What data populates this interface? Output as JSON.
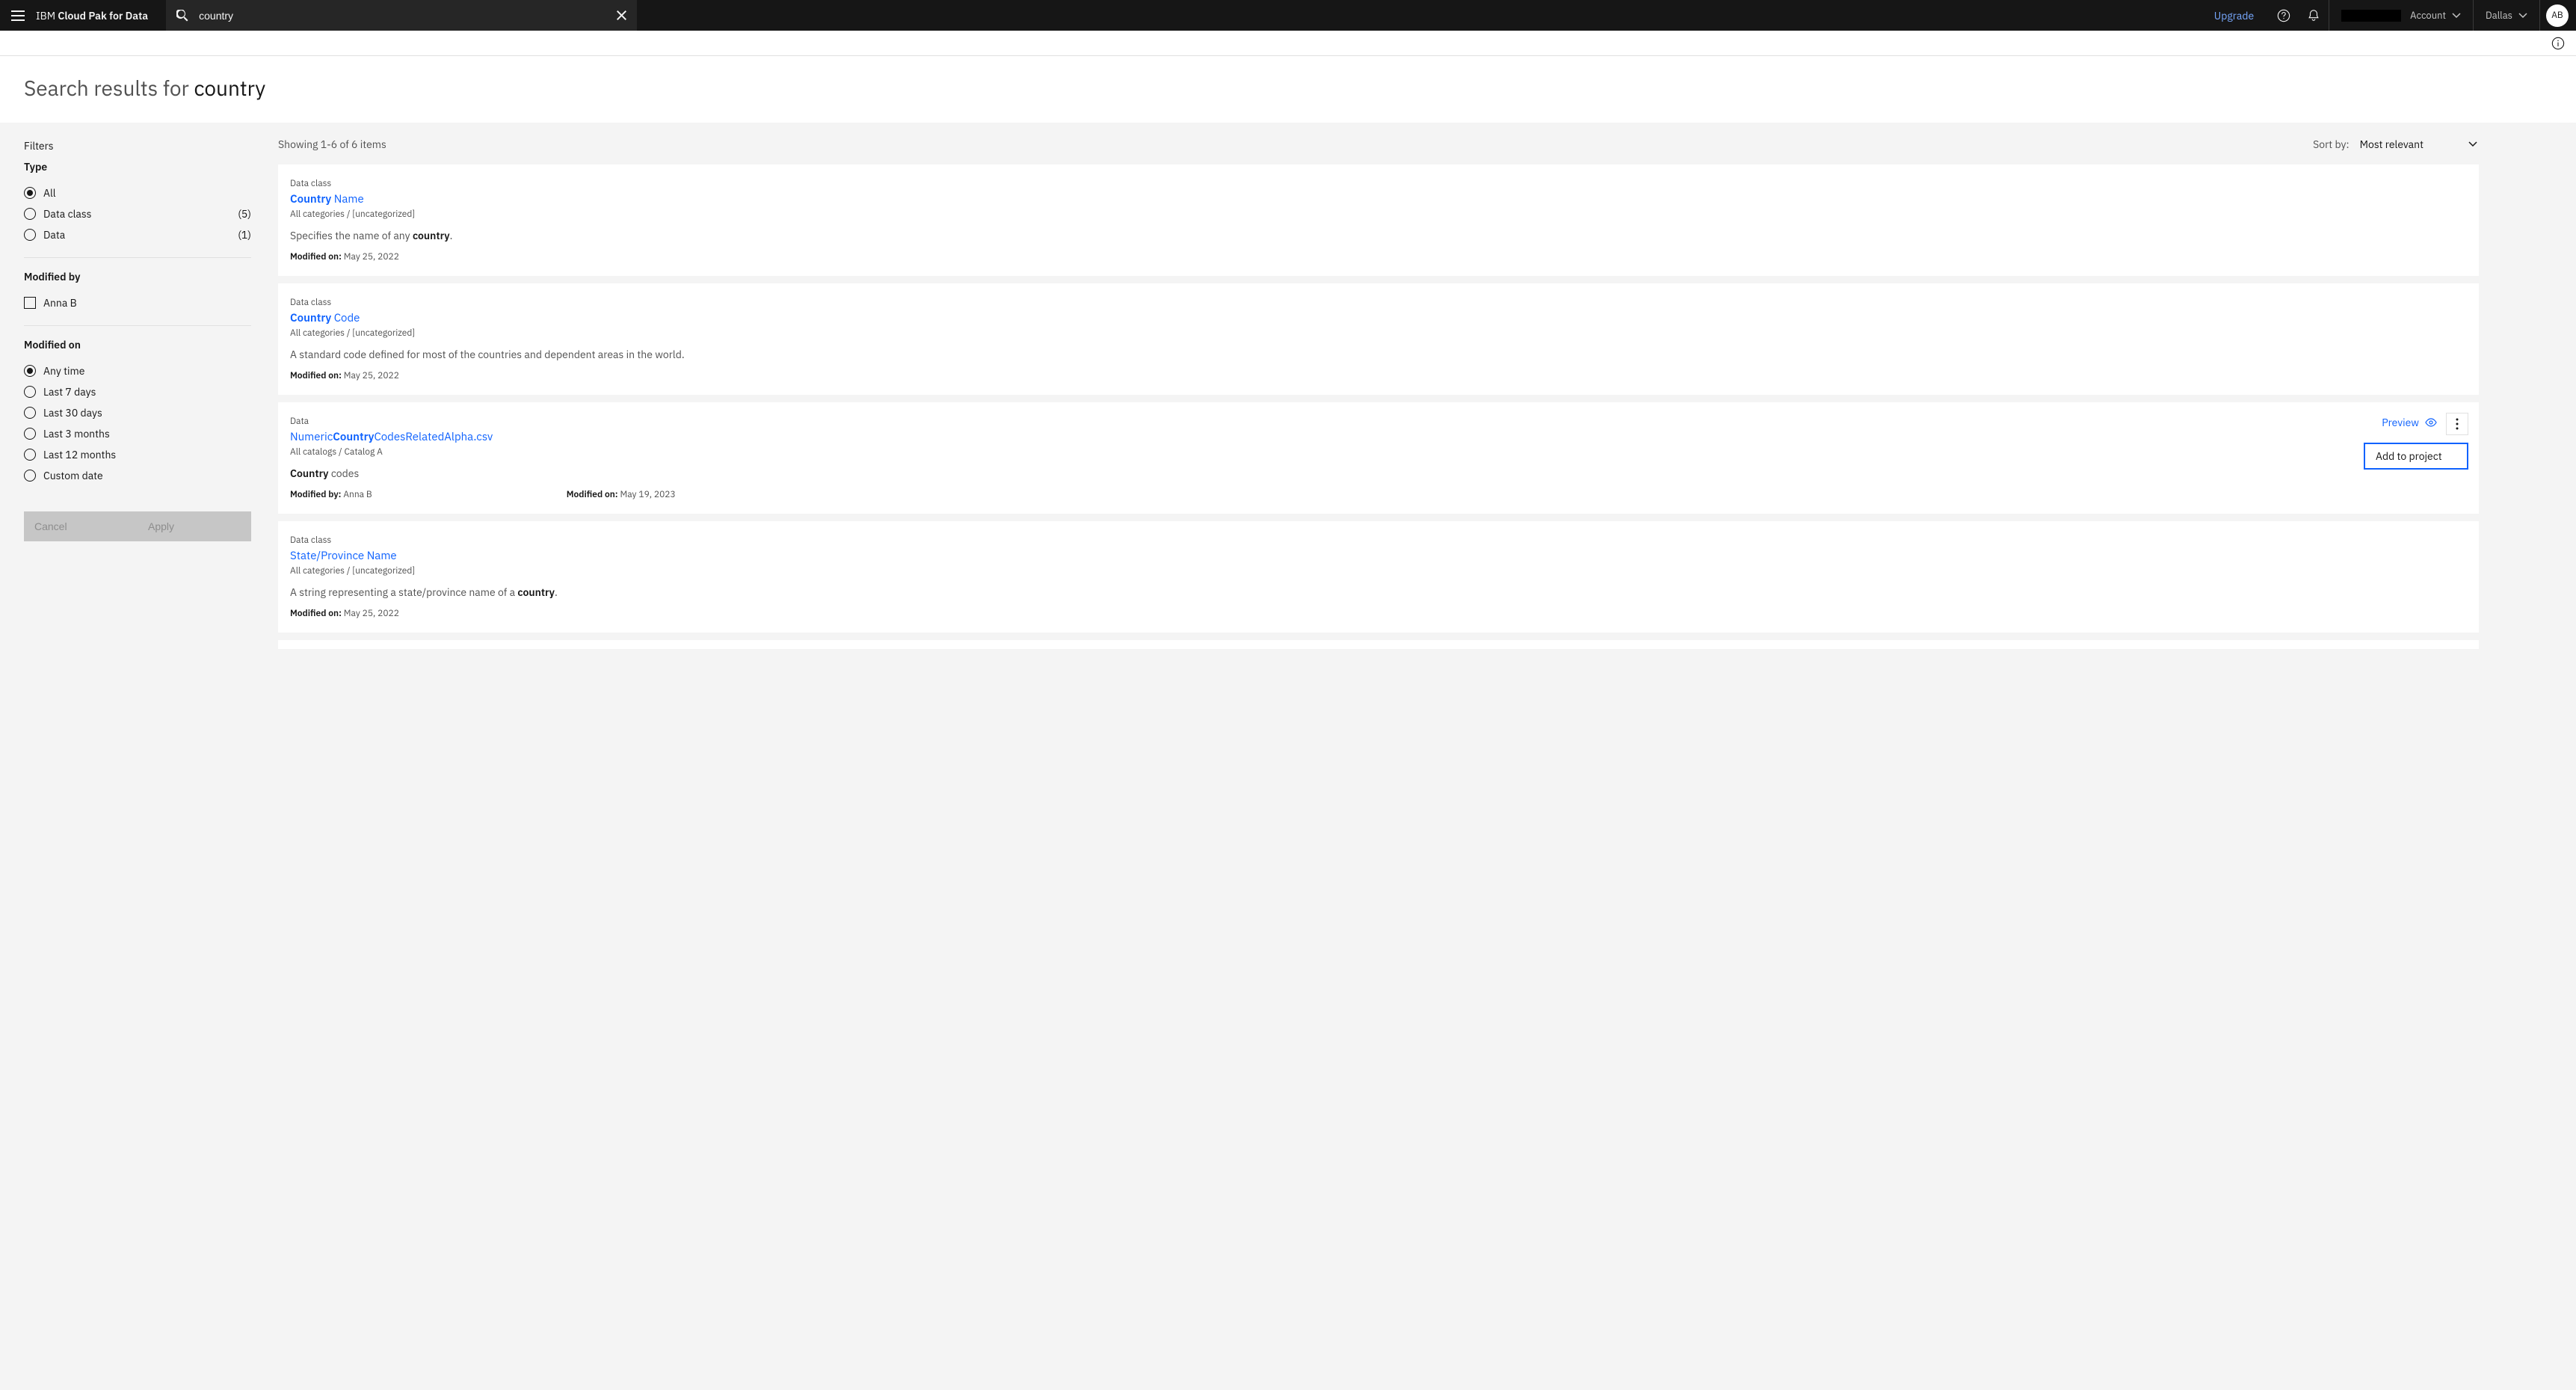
{
  "header": {
    "brand_prefix": "IBM ",
    "brand_bold": "Cloud Pak for Data",
    "search_value": "country",
    "upgrade": "Upgrade",
    "account_label": "Account",
    "region_label": "Dallas",
    "avatar_initials": "AB"
  },
  "page": {
    "title_prefix": "Search results for ",
    "title_term": "country"
  },
  "filters": {
    "heading": "Filters",
    "type": {
      "title": "Type",
      "options": [
        {
          "label": "All",
          "count": "",
          "selected": true
        },
        {
          "label": "Data class",
          "count": "(5)",
          "selected": false
        },
        {
          "label": "Data",
          "count": "(1)",
          "selected": false
        }
      ]
    },
    "modified_by": {
      "title": "Modified by",
      "options": [
        {
          "label": "Anna B",
          "checked": false
        }
      ]
    },
    "modified_on": {
      "title": "Modified on",
      "options": [
        {
          "label": "Any time",
          "selected": true
        },
        {
          "label": "Last 7 days",
          "selected": false
        },
        {
          "label": "Last 30 days",
          "selected": false
        },
        {
          "label": "Last 3 months",
          "selected": false
        },
        {
          "label": "Last 12 months",
          "selected": false
        },
        {
          "label": "Custom date",
          "selected": false
        }
      ]
    },
    "cancel": "Cancel",
    "apply": "Apply"
  },
  "results_header": {
    "showing": "Showing 1-6 of 6 items",
    "sort_label": "Sort by:",
    "sort_value": "Most relevant"
  },
  "results": [
    {
      "type": "Data class",
      "title_hl": "Country",
      "title_rest": " Name",
      "path": "All categories / [uncategorized]",
      "desc_pre": "Specifies the name of any ",
      "desc_hl": "country",
      "desc_post": ".",
      "modified_on_label": "Modified on:",
      "modified_on_value": " May 25, 2022"
    },
    {
      "type": "Data class",
      "title_hl": "Country",
      "title_rest": " Code",
      "path": "All categories / [uncategorized]",
      "desc_pre": "A standard code defined for most of the countries and dependent areas in the world.",
      "desc_hl": "",
      "desc_post": "",
      "modified_on_label": "Modified on:",
      "modified_on_value": " May 25, 2022"
    },
    {
      "type": "Data",
      "title_pre": "Numeric",
      "title_hl": "Country",
      "title_rest": "CodesRelatedAlpha.csv",
      "path": "All catalogs / Catalog A",
      "desc_pre": "",
      "desc_hl": "Country",
      "desc_post": " codes",
      "modified_by_label": "Modified by:",
      "modified_by_value": " Anna B",
      "modified_on_label": "Modified on:",
      "modified_on_value": " May 19, 2023",
      "preview_label": "Preview",
      "menu_item": "Add to project"
    },
    {
      "type": "Data class",
      "title_hl": "",
      "title_rest": "State/Province Name",
      "path": "All categories / [uncategorized]",
      "desc_pre": "A string representing a state/province name of a ",
      "desc_hl": "country",
      "desc_post": ".",
      "modified_on_label": "Modified on:",
      "modified_on_value": " May 25, 2022"
    }
  ]
}
